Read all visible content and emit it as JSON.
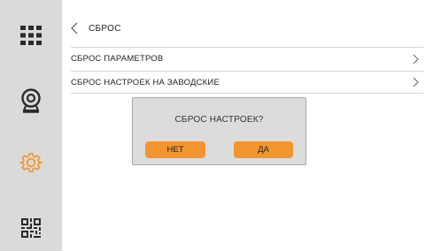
{
  "colors": {
    "sidebar_bg": "#dadada",
    "accent": "#f2952f",
    "icon_dark": "#2b2b2b",
    "dialog_bg": "#dcdcdc"
  },
  "sidebar": {
    "items": [
      {
        "icon": "apps-grid-icon"
      },
      {
        "icon": "camera-icon"
      },
      {
        "icon": "gear-icon",
        "active": true
      },
      {
        "icon": "qr-code-icon"
      }
    ]
  },
  "header": {
    "back_icon": "chevron-left-icon",
    "title": "СБРОС"
  },
  "rows": [
    {
      "label": "СБРОС ПАРАМЕТРОВ",
      "icon": "chevron-right-icon"
    },
    {
      "label": "СБРОС НАСТРОЕК НА ЗАВОДСКИЕ",
      "icon": "chevron-right-icon"
    }
  ],
  "dialog": {
    "message": "СБРОС НАСТРОЕК?",
    "no_label": "НЕТ",
    "yes_label": "ДА"
  }
}
